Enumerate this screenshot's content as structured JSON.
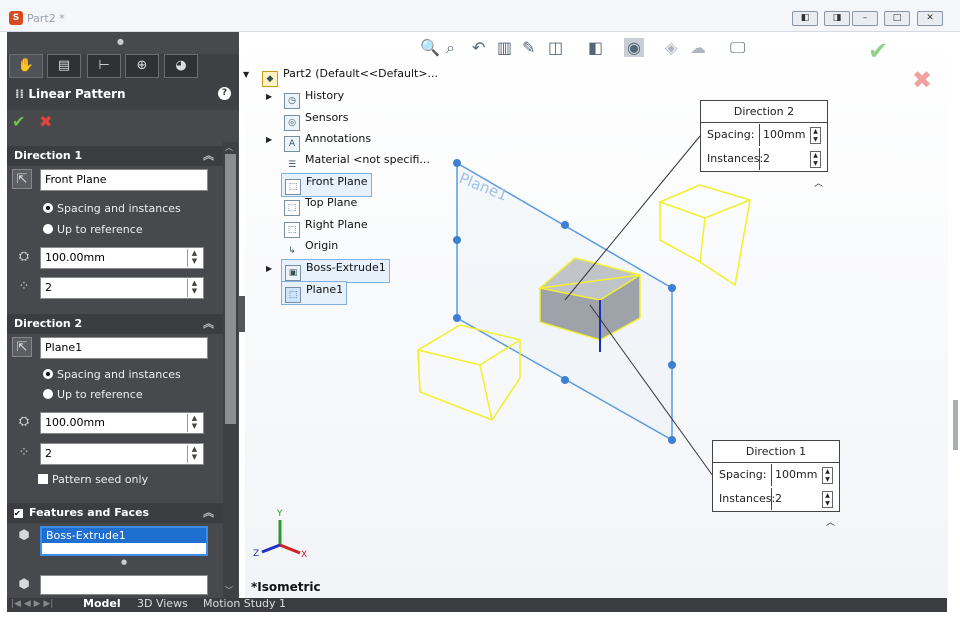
{
  "window": {
    "title": "Part2 *"
  },
  "property_manager": {
    "title": "Linear Pattern",
    "direction1": {
      "header": "Direction 1",
      "reference": "Front Plane",
      "option_spacing": "Spacing and instances",
      "option_reference": "Up to reference",
      "spacing": "100.00mm",
      "instances": "2"
    },
    "direction2": {
      "header": "Direction 2",
      "reference": "Plane1",
      "option_spacing": "Spacing and instances",
      "option_reference": "Up to reference",
      "spacing": "100.00mm",
      "instances": "2",
      "pattern_seed_only": "Pattern seed only"
    },
    "features": {
      "header": "Features and Faces",
      "item": "Boss-Extrude1"
    }
  },
  "tree": {
    "root": "Part2  (Default<<Default>...",
    "items": [
      "History",
      "Sensors",
      "Annotations",
      "Material <not specifi...",
      "Front Plane",
      "Top Plane",
      "Right Plane",
      "Origin",
      "Boss-Extrude1",
      "Plane1"
    ]
  },
  "callout_dir2": {
    "title": "Direction 2",
    "spacing_label": "Spacing:",
    "spacing": "100mm",
    "instances_label": "Instances:",
    "instances": "2"
  },
  "callout_dir1": {
    "title": "Direction 1",
    "spacing_label": "Spacing:",
    "spacing": "100mm",
    "instances_label": "Instances:",
    "instances": "2"
  },
  "viewport": {
    "view_label": "*Isometric",
    "plane_label": "Plane1"
  },
  "bottom_tabs": [
    "Model",
    "3D Views",
    "Motion Study 1"
  ],
  "colors": {
    "accent": "#f2c230",
    "preview": "#ffff33",
    "plane": "#4a90d9"
  }
}
